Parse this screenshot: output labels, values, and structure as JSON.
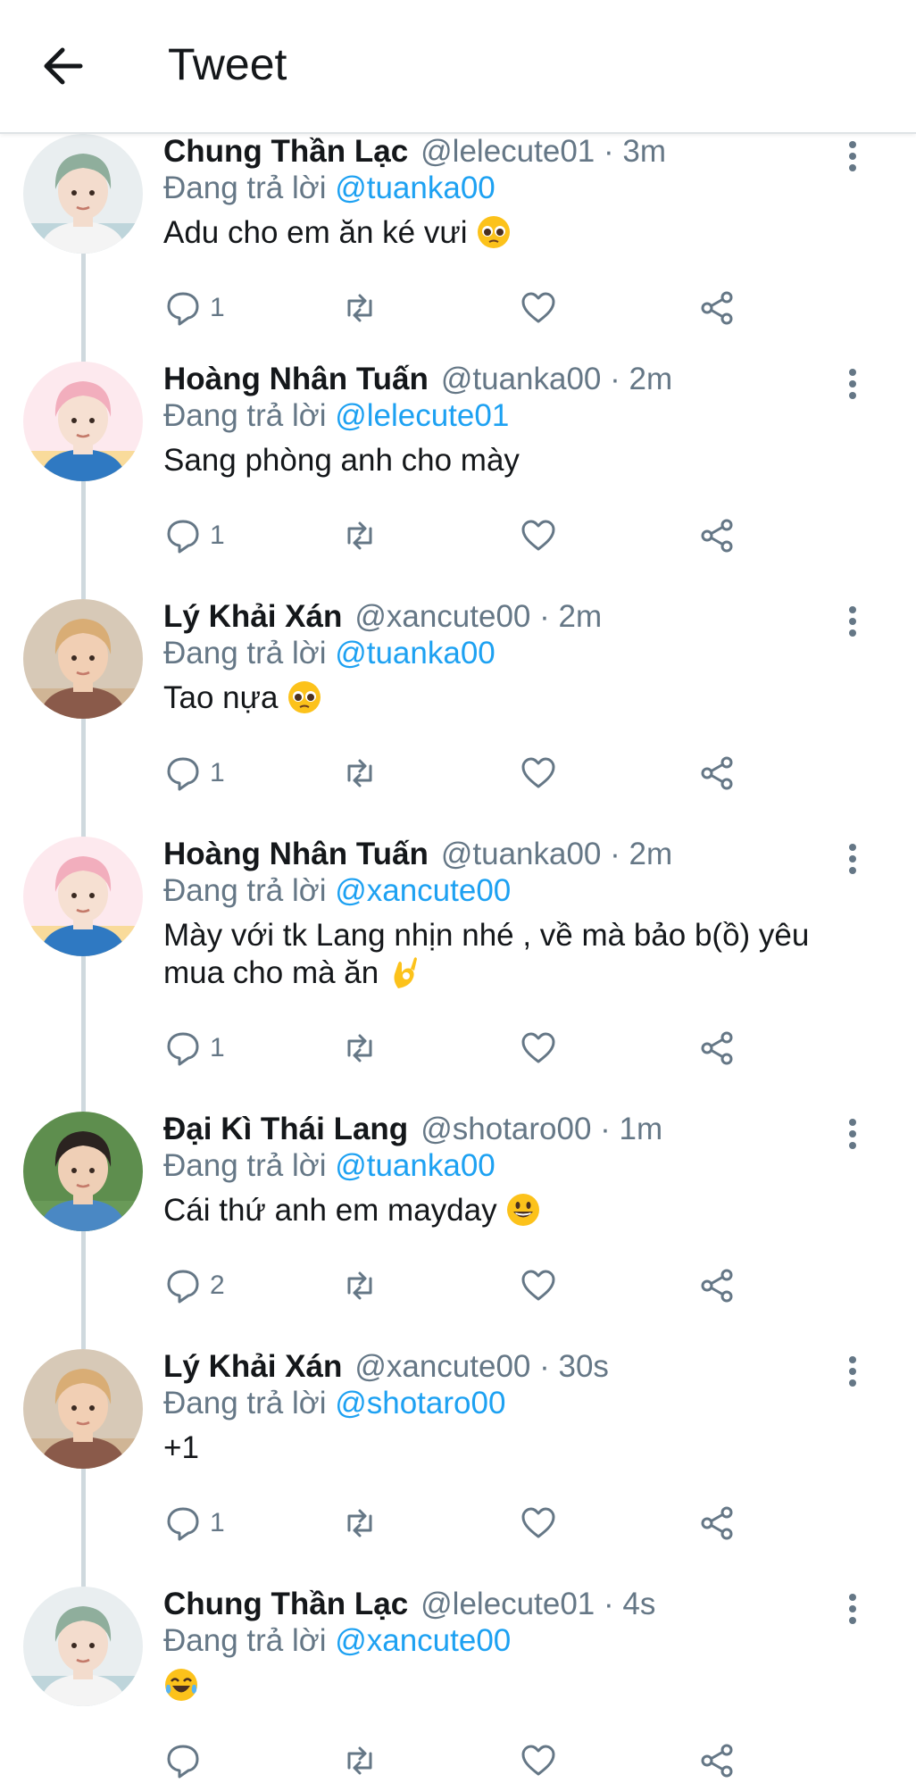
{
  "header": {
    "title": "Tweet"
  },
  "tweets": [
    {
      "name": "Chung Thần Lạc",
      "handle": "@lelecute01",
      "time": "3m",
      "replying_label": "Đang trả lời",
      "replying_to": "@tuanka00",
      "text": "Adu cho em ăn ké vưi",
      "emoji": "pleading-face",
      "reply_count": "1",
      "avatar": "avatar-green-hair"
    },
    {
      "name": "Hoàng Nhân Tuấn",
      "handle": "@tuanka00",
      "time": "2m",
      "replying_label": "Đang trả lời",
      "replying_to": "@lelecute01",
      "text": "Sang phòng anh cho mày",
      "emoji": "",
      "reply_count": "1",
      "avatar": "avatar-pink-hair"
    },
    {
      "name": "Lý Khải Xán",
      "handle": "@xancute00",
      "time": "2m",
      "replying_label": "Đang trả lời",
      "replying_to": "@tuanka00",
      "text": "Tao nựa",
      "emoji": "pleading-face",
      "reply_count": "1",
      "avatar": "avatar-blonde-hair"
    },
    {
      "name": "Hoàng Nhân Tuấn",
      "handle": "@tuanka00",
      "time": "2m",
      "replying_label": "Đang trả lời",
      "replying_to": "@xancute00",
      "text": "Mày với tk Lang nhịn nhé , về mà bảo b(ồ) yêu mua cho mà ăn",
      "emoji": "ok-hand",
      "reply_count": "1",
      "avatar": "avatar-pink-hair"
    },
    {
      "name": "Đại Kì Thái Lang",
      "handle": "@shotaro00",
      "time": "1m",
      "replying_label": "Đang trả lời",
      "replying_to": "@tuanka00",
      "text": "Cái thứ anh em mayday",
      "emoji": "grinning-face",
      "reply_count": "2",
      "avatar": "avatar-dark-hair"
    },
    {
      "name": "Lý Khải Xán",
      "handle": "@xancute00",
      "time": "30s",
      "replying_label": "Đang trả lời",
      "replying_to": "@shotaro00",
      "text": "+1",
      "emoji": "",
      "reply_count": "1",
      "avatar": "avatar-blonde-hair"
    },
    {
      "name": "Chung Thần Lạc",
      "handle": "@lelecute01",
      "time": "4s",
      "replying_label": "Đang trả lời",
      "replying_to": "@xancute00",
      "text": "",
      "emoji": "tears-of-joy",
      "reply_count": "",
      "avatar": "avatar-green-hair"
    }
  ],
  "colors": {
    "link": "#1da1f2",
    "secondary": "#657786",
    "text": "#14171a",
    "divider": "#cfd9de"
  }
}
